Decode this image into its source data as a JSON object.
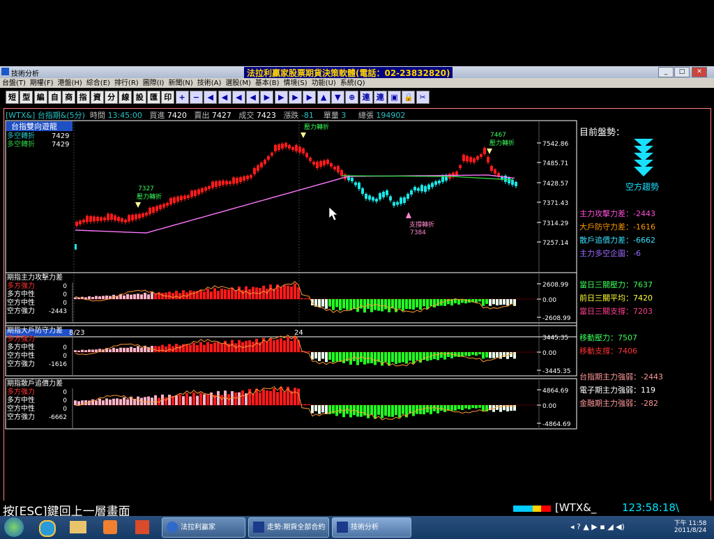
{
  "window": {
    "title": "技術分析",
    "app_title": "法拉利贏家股票期貨決策軟體(電話：02-23832820)",
    "min": "_",
    "max": "□",
    "close": "✕"
  },
  "menu": [
    "台盤(T)",
    "期權(F)",
    "港盤(H)",
    "綜合(E)",
    "排行(R)",
    "圖際(I)",
    "新聞(N)",
    "技術(A)",
    "選股(M)",
    "基本(B)",
    "情境(S)",
    "功能(U)",
    "系統(Q)"
  ],
  "toolbar": [
    "短",
    "型",
    "編",
    "自",
    "商",
    "指",
    "資",
    "分",
    "線",
    "設",
    "匯",
    "印",
    "+",
    "−",
    "◀",
    "◀",
    "◀",
    "◀",
    "▶",
    "▶",
    "▶",
    "▶",
    "▲",
    "▼",
    "⊕",
    "連",
    "連",
    "▣",
    "🔒",
    "✂"
  ],
  "status": {
    "symbol": "[WTX&]",
    "name": "台指期&(5分)",
    "time_label": "時間",
    "time": "13:45:00",
    "bid_label": "買進",
    "bid": "7420",
    "ask_label": "賣出",
    "ask": "7427",
    "deal_label": "成交",
    "deal": "7423",
    "change_label": "漲跌",
    "change": "-81",
    "vol_label": "單量",
    "vol": "3",
    "total_label": "總張",
    "total": "194902"
  },
  "legend": {
    "header": "台指雙向遊龍",
    "line1_label": "多空轉折",
    "line1_val": "7429",
    "line2_label": "多空轉折",
    "line2_val": "7429"
  },
  "main_chart": {
    "y_ticks": [
      "7542.86",
      "7485.71",
      "7428.57",
      "7371.43",
      "7314.29",
      "7257.14"
    ],
    "x_labels": [
      "8/23",
      "24"
    ],
    "annot_1_val": "7327",
    "annot_1_text": "壓力轉折",
    "annot_2_text": "壓力轉折",
    "annot_3_val": "7467",
    "annot_3_text": "壓力轉折",
    "annot_4_text": "支撐轉折",
    "annot_4_val": "7384"
  },
  "sub_charts": [
    {
      "title": "期指主力攻擊力差",
      "rows": [
        [
          "多方強力",
          "0"
        ],
        [
          "多方中性",
          "0"
        ],
        [
          "空方中性",
          "0"
        ],
        [
          "空方強力",
          "-2443"
        ]
      ],
      "ticks": [
        "2608.99",
        "0.00",
        "-2608.99"
      ]
    },
    {
      "title": "期指大戶防守力差",
      "rows": [
        [
          "多方強力",
          ""
        ],
        [
          "多方中性",
          "0"
        ],
        [
          "空方中性",
          "0"
        ],
        [
          "空方強力",
          "-1616"
        ]
      ],
      "ticks": [
        "3445.35",
        "0.00",
        "-3445.35"
      ]
    },
    {
      "title": "期指散戶追價力差",
      "rows": [
        [
          "多方強力",
          "0"
        ],
        [
          "多方中性",
          "0"
        ],
        [
          "空方中性",
          "0"
        ],
        [
          "空方強力",
          "-6662"
        ]
      ],
      "ticks": [
        "4864.69",
        "0.00",
        "-4864.69"
      ]
    }
  ],
  "right_panel": {
    "heading": "目前盤勢：",
    "trend": "空方趨勢",
    "items": [
      {
        "text": "主力攻擊力差：-2443",
        "color": "#ff4fd8"
      },
      {
        "text": "大戶防守力差：-1616",
        "color": "#ff9900"
      },
      {
        "text": "散戶追價力差：-6662",
        "color": "#39e0ff"
      },
      {
        "text": "主力多空企圖：-6",
        "color": "#9a6bff"
      },
      {
        "text": "當日三關壓力：7637",
        "color": "#39ff5a"
      },
      {
        "text": "前日三關平均：7420",
        "color": "#ffff33"
      },
      {
        "text": "當日三關支撐：7203",
        "color": "#ff3f8f"
      },
      {
        "text": "移動壓力：7507",
        "color": "#39ff5a"
      },
      {
        "text": "移動支撐：7406",
        "color": "#ff3333"
      },
      {
        "text": "台指期主力強弱：-2443",
        "color": "#ff9999"
      },
      {
        "text": "電子期主力強弱：119",
        "color": "#ffffff"
      },
      {
        "text": "金融期主力強弱：-282",
        "color": "#ff9999"
      }
    ]
  },
  "bottom": {
    "hint": "按[ESC]鍵回上一層畫面",
    "symbol": "[WTX&_",
    "clock": "123:58:18\\"
  },
  "taskbar": {
    "tasks": [
      "法拉利贏家",
      "走勢:期貨全部合約",
      "技術分析"
    ],
    "time": "下午 11:58",
    "date": "2011/8/24"
  },
  "colors": {
    "up": "#ff1a1a",
    "down": "#19e6e6",
    "ma": "#ff77ff",
    "green_line": "#2ecc40",
    "bar_down": "#22ff22",
    "bar_up": "#ff1a1a"
  }
}
